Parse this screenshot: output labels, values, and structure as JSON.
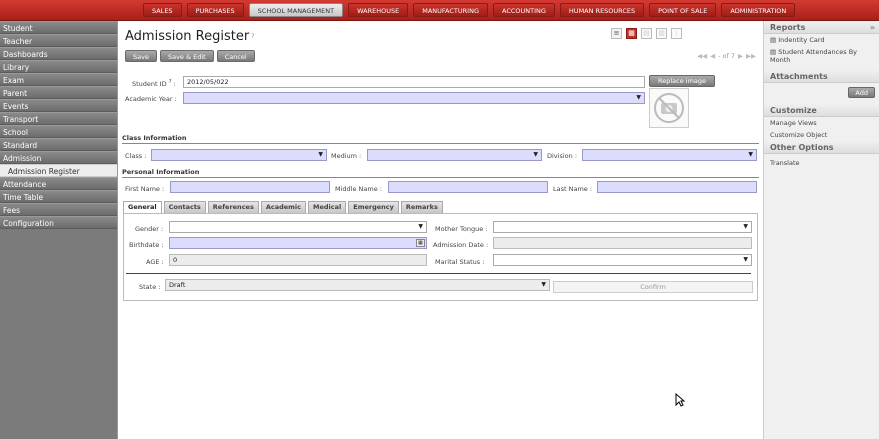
{
  "top_nav": [
    "SALES",
    "PURCHASES",
    "SCHOOL MANAGEMENT",
    "WAREHOUSE",
    "MANUFACTURING",
    "ACCOUNTING",
    "HUMAN RESOURCES",
    "POINT OF SALE",
    "ADMINISTRATION"
  ],
  "top_nav_active": "SCHOOL MANAGEMENT",
  "sidebar": [
    "Student",
    "Teacher",
    "Dashboards",
    "Library",
    "Exam",
    "Parent",
    "Events",
    "Transport",
    "School",
    "Standard",
    "Admission",
    "Admission Register",
    "Attendance",
    "Time Table",
    "Fees",
    "Configuration"
  ],
  "page": {
    "title": "Admission Register",
    "title_help": "?",
    "buttons": {
      "save": "Save",
      "save_edit": "Save & Edit",
      "cancel": "Cancel"
    },
    "pager": "- of 7"
  },
  "form": {
    "student_id_label": "Student ID",
    "student_id_help": "?",
    "student_id_value": "2012/05/022",
    "academic_year_label": "Academic Year :",
    "replace_image": "Replace image",
    "class_info": "Class Information",
    "class_label": "Class :",
    "medium_label": "Medium :",
    "division_label": "Division :",
    "personal_info": "Personal Information",
    "first_name_label": "First Name :",
    "middle_name_label": "Middle Name :",
    "last_name_label": "Last Name :"
  },
  "tabs": [
    "General",
    "Contacts",
    "References",
    "Academic",
    "Medical",
    "Emergency",
    "Remarks"
  ],
  "general": {
    "gender_label": "Gender :",
    "birthdate_label": "Birthdate :",
    "age_label": "AGE :",
    "age_value": "0",
    "mother_tongue_label": "Mother Tongue :",
    "admission_date_label": "Admission Date :",
    "marital_status_label": "Marital Status :",
    "state_label": "State :",
    "state_value": "Draft",
    "confirm": "Confirm"
  },
  "right_panel": {
    "reports_title": "Reports",
    "reports": [
      "Indentity Card",
      "Student Attendances By Month"
    ],
    "attachments_title": "Attachments",
    "add": "Add",
    "customize_title": "Customize",
    "customize": [
      "Manage Views",
      "Customize Object"
    ],
    "other_title": "Other Options",
    "other": [
      "Translate"
    ]
  },
  "colors": {
    "brand_red": "#c0312a",
    "required_field": "#dcdcfc"
  }
}
